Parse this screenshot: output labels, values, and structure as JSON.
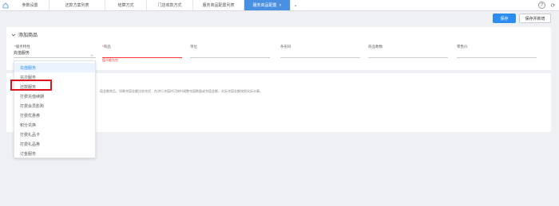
{
  "tabs": [
    {
      "label": "参数设置"
    },
    {
      "label": "还款方案列表"
    },
    {
      "label": "结算方式"
    },
    {
      "label": "门店收款方式"
    },
    {
      "label": "服务商品配置列表"
    },
    {
      "label": "服务商品配置",
      "active": true
    }
  ],
  "actions": {
    "save_label": "保存",
    "save_new_label": "保存并新增"
  },
  "section": {
    "title": "添加商品"
  },
  "fields": {
    "service_attr_label": "*服务特性",
    "service_attr_value": "充值服务",
    "goods_label": "商品",
    "goods_error": "值不能为空",
    "unit_label": "单位",
    "code_label": "条形码",
    "count_label": "商品数数",
    "price_label": "零售价"
  },
  "dropdown": {
    "options": [
      "充值服务",
      "充次服务",
      "还款服务",
      "打费充值续期",
      "打费会员影购",
      "打费优惠券",
      "积分兑换",
      "打费礼品卡",
      "打费礼品券",
      "订金服务"
    ],
    "selected_index": 0,
    "highlighted_index": 2
  },
  "tip": "…值金额商品，如果充值金额比较充优，在进行充值时可按时调整充值数量或充值金额，实际充值金额按照实际计算。",
  "colors": {
    "accent": "#2d8cf0",
    "highlight": "#e0121a",
    "error": "#e33333"
  }
}
